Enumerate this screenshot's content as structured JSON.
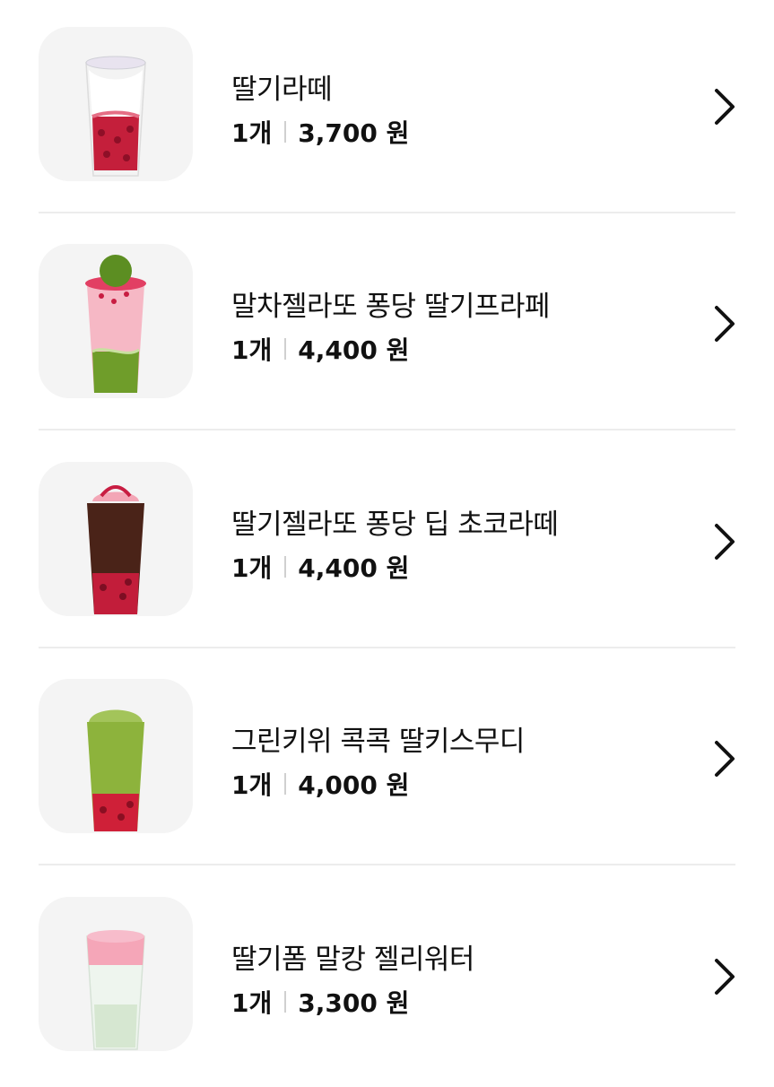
{
  "items": [
    {
      "name": "딸기라떼",
      "qty": "1개",
      "price": "3,700 원",
      "icon": "strawberry-latte-image"
    },
    {
      "name": "말차젤라또 퐁당 딸기프라페",
      "qty": "1개",
      "price": "4,400 원",
      "icon": "matcha-strawberry-frappe-image"
    },
    {
      "name": "딸기젤라또 퐁당 딥 초코라떼",
      "qty": "1개",
      "price": "4,400 원",
      "icon": "strawberry-choco-latte-image"
    },
    {
      "name": "그린키위 콕콕 딸키스무디",
      "qty": "1개",
      "price": "4,000 원",
      "icon": "green-kiwi-smoothie-image"
    },
    {
      "name": "딸기폼 말캉 젤리워터",
      "qty": "1개",
      "price": "3,300 원",
      "icon": "strawberry-jelly-water-image"
    }
  ]
}
